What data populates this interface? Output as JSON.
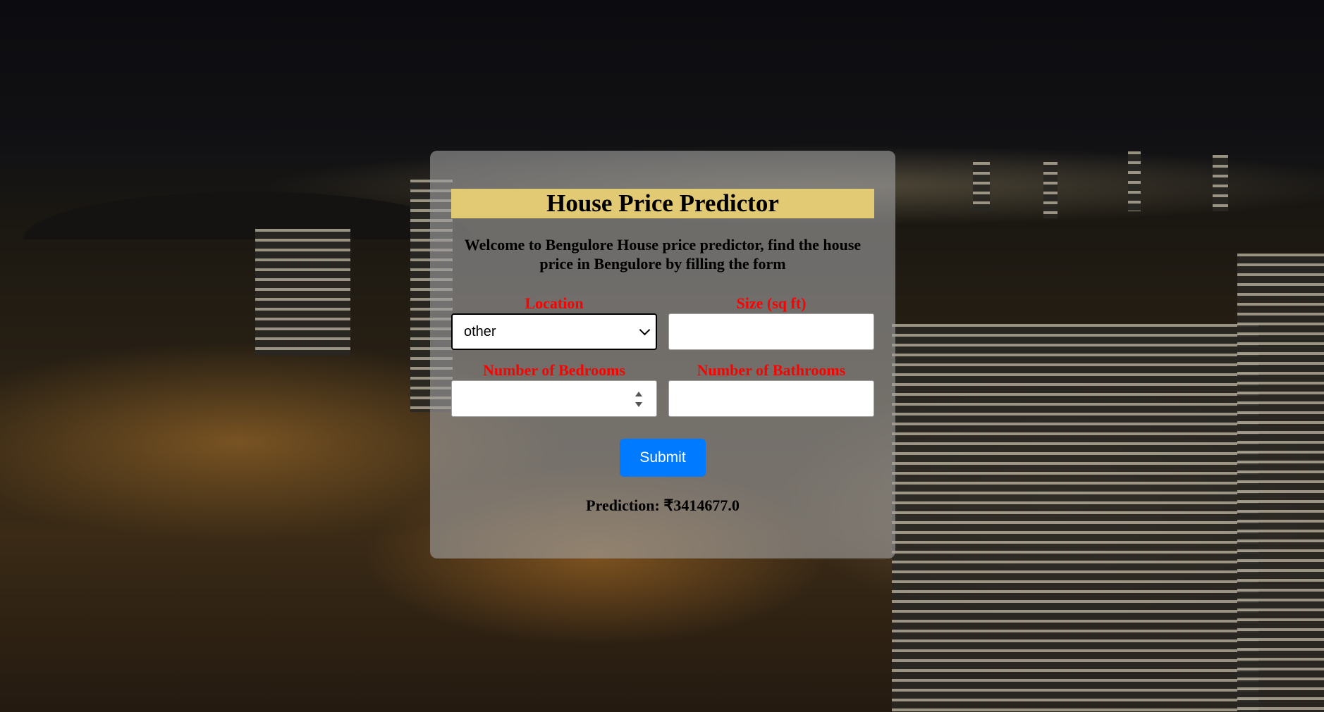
{
  "page": {
    "title": "House Price Predictor",
    "intro": "Welcome to Bengulore House price predictor, find the house price in Bengulore by filling the form"
  },
  "form": {
    "location": {
      "label": "Location",
      "selected": "other"
    },
    "size": {
      "label": "Size (sq ft)",
      "value": ""
    },
    "bedrooms": {
      "label": "Number of Bedrooms",
      "value": ""
    },
    "bathrooms": {
      "label": "Number of Bathrooms",
      "value": ""
    },
    "submit_label": "Submit"
  },
  "result": {
    "prediction": "Prediction: ₹3414677.0"
  },
  "colors": {
    "title_bg": "#e2c974",
    "label": "#ff0000",
    "button": "#007bff",
    "card": "rgba(160,160,160,0.62)"
  },
  "icons": {
    "select_arrow": "chevron-down-icon",
    "number_spinner": "spinner-icon"
  }
}
